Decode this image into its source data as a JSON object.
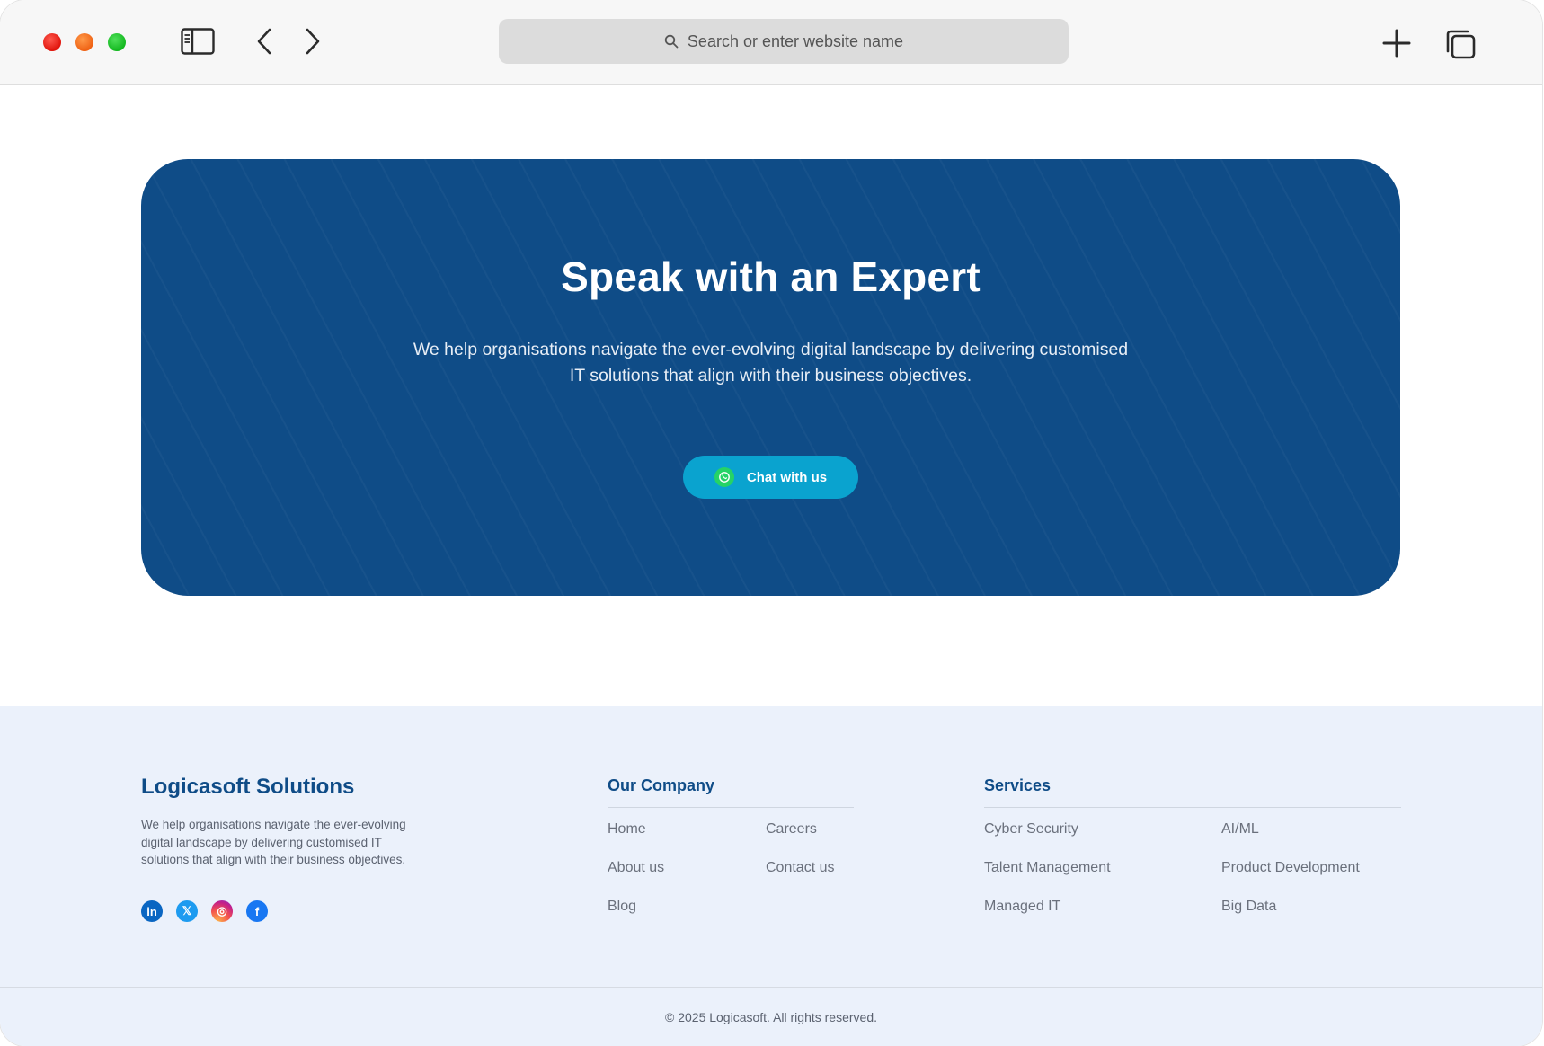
{
  "browser": {
    "search_placeholder": "Search or enter website name",
    "icons": {
      "sidebar": "sidebar-icon",
      "back": "chevron-left-icon",
      "forward": "chevron-right-icon",
      "search": "search-icon",
      "new_tab": "plus-icon",
      "tabs": "tabs-overview-icon"
    }
  },
  "hero": {
    "title": "Speak with an Expert",
    "description_line1": "We help organisations navigate the ever-evolving digital landscape by delivering customised",
    "description_line2": "IT solutions that align with their business objectives.",
    "cta_label": "Chat with us",
    "cta_icon": "whatsapp-icon"
  },
  "footer": {
    "brand": {
      "name": "Logicasoft Solutions",
      "description_line1": "We help organisations navigate the ever-evolving",
      "description_line2": "digital landscape by delivering customised IT",
      "description_line3": "solutions that align with their business objectives."
    },
    "socials": [
      {
        "name": "linkedin-icon",
        "glyph": "in"
      },
      {
        "name": "x-icon",
        "glyph": "𝕏"
      },
      {
        "name": "instagram-icon",
        "glyph": "◎"
      },
      {
        "name": "facebook-icon",
        "glyph": "f"
      }
    ],
    "our_company": {
      "title": "Our Company",
      "links": [
        "Home",
        "Careers",
        "About us",
        "Contact us",
        "Blog"
      ]
    },
    "services": {
      "title": "Services",
      "links": [
        "Cyber Security",
        "AI/ML",
        "Talent Management",
        "Product Development",
        "Managed IT",
        "Big Data"
      ]
    },
    "copyright": "© 2025 Logicasoft. All rights reserved."
  },
  "colors": {
    "primary": "#0f4c87",
    "cta": "#0aa3cf",
    "footer_bg": "#ebf1fb"
  }
}
